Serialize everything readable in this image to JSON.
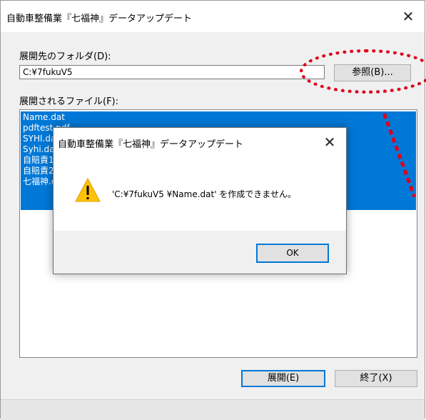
{
  "window": {
    "title": "自動車整備業『七福神』データアップデート",
    "close_glyph": "✕"
  },
  "folder": {
    "label": "展開先のフォルダ(D):",
    "value": "C:¥7fukuV5",
    "browse_label": "参照(B)..."
  },
  "files": {
    "label": "展開されるファイル(F):",
    "items": [
      "Name.dat",
      "pdftest.pdf",
      "SYHI.dat",
      "Syhi.dat",
      "自賠責1.dat",
      "自賠責2.dat",
      "七福神.dat"
    ]
  },
  "buttons": {
    "extract_label": "展開(E)",
    "exit_label": "終了(X)"
  },
  "dialog": {
    "title": "自動車整備業『七福神』データアップデート",
    "close_glyph": "✕",
    "message": "'C:¥7fukuV5 ¥Name.dat' を作成できません。",
    "ok_label": "OK",
    "icon": "warning-icon"
  },
  "colors": {
    "selection": "#0078d7",
    "annotation": "#e0001b",
    "warning": "#ffc107"
  }
}
